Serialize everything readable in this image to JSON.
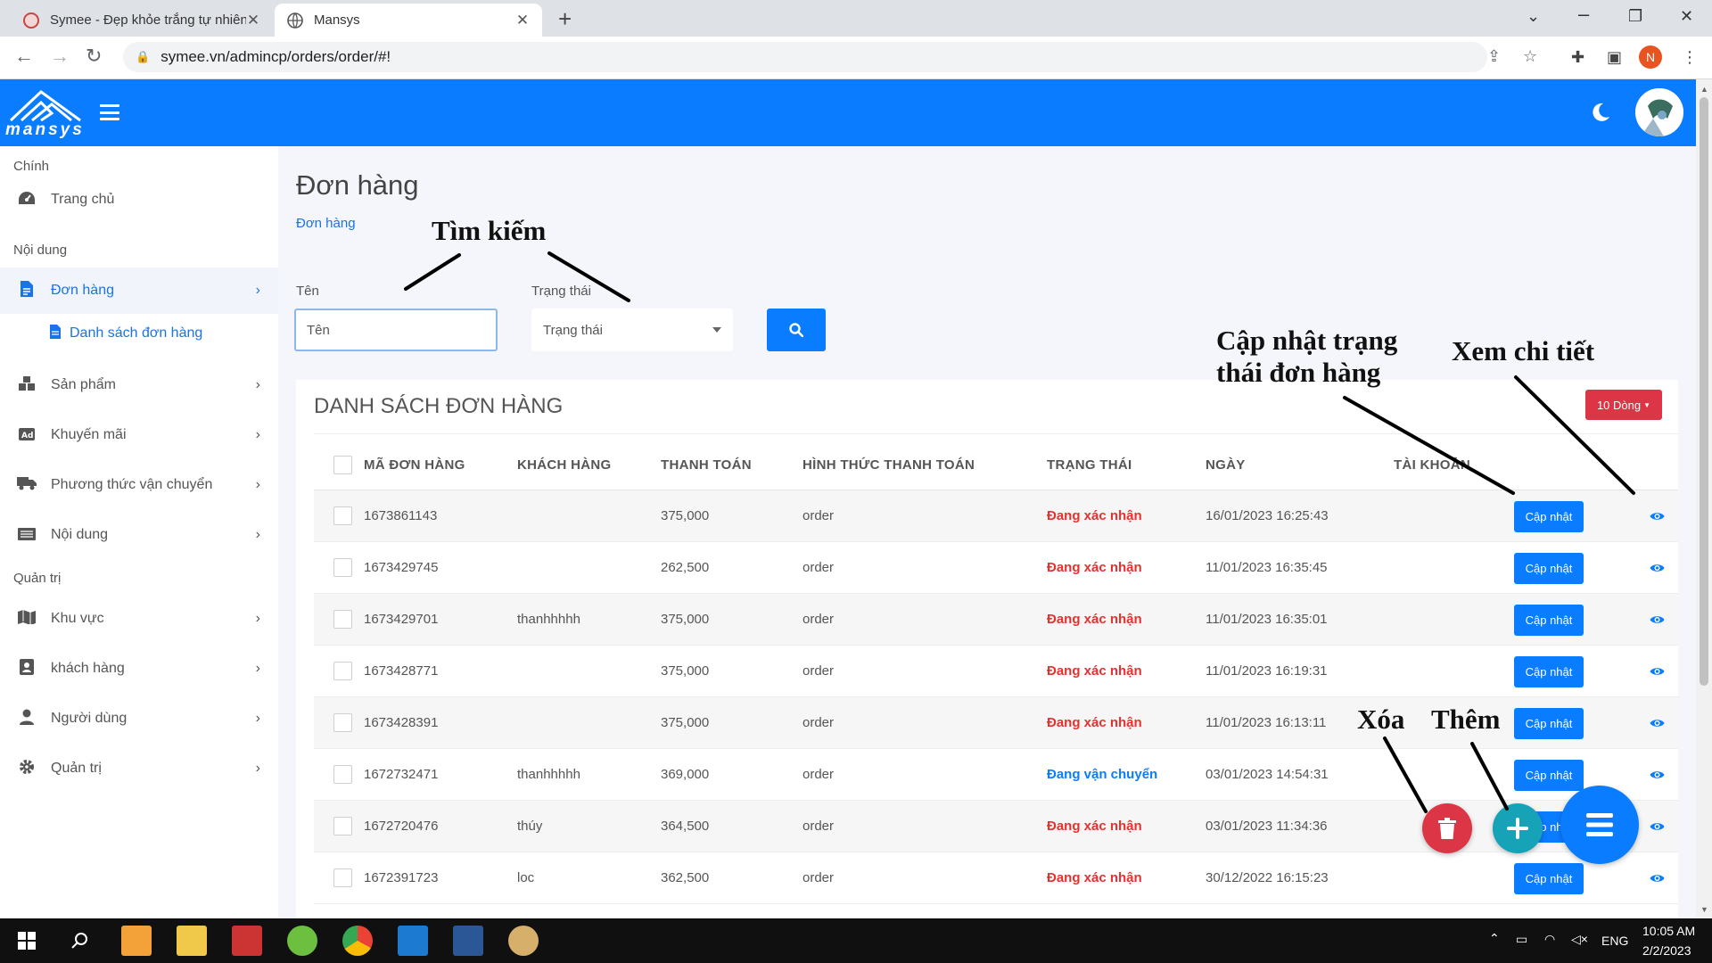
{
  "browser": {
    "tabs": [
      {
        "title": "Symee - Đẹp khỏe trắng tự nhiên",
        "active": false
      },
      {
        "title": "Mansys",
        "active": true
      }
    ],
    "url": "symee.vn/admincp/orders/order/#!",
    "profile_initial": "N"
  },
  "app": {
    "logo_text": "mansys",
    "brand_color": "#0a7cff"
  },
  "sidebar": {
    "section_main": "Chính",
    "section_content": "Nội dung",
    "section_admin": "Quản trị",
    "items": [
      {
        "label": "Trang chủ",
        "icon": "dashboard-icon"
      },
      {
        "label": "Đơn hàng",
        "icon": "invoice-icon",
        "active": true
      },
      {
        "label": "Sản phẩm",
        "icon": "boxes-icon"
      },
      {
        "label": "Khuyến mãi",
        "icon": "ad-icon"
      },
      {
        "label": "Phương thức vận chuyển",
        "icon": "truck-icon"
      },
      {
        "label": "Nội dung",
        "icon": "news-icon"
      },
      {
        "label": "Khu vực",
        "icon": "map-icon"
      },
      {
        "label": "khách hàng",
        "icon": "contact-icon"
      },
      {
        "label": "Người dùng",
        "icon": "user-icon"
      },
      {
        "label": "Quản trị",
        "icon": "gear-icon"
      }
    ],
    "subitem": "Danh sách đơn hàng"
  },
  "page": {
    "title": "Đơn hàng",
    "breadcrumb": "Đơn hàng",
    "filter": {
      "name_label": "Tên",
      "name_placeholder": "Tên",
      "status_label": "Trạng thái",
      "status_value": "Trạng thái"
    }
  },
  "table": {
    "title": "DANH SÁCH ĐƠN HÀNG",
    "rows_button": "10 Dòng",
    "columns": [
      "MÃ ĐƠN HÀNG",
      "KHÁCH HÀNG",
      "THANH TOÁN",
      "HÌNH THỨC THANH TOÁN",
      "TRẠNG THÁI",
      "NGÀY",
      "TÀI KHOẢN"
    ],
    "update_label": "Cập nhật",
    "rows": [
      {
        "id": "1673861143",
        "customer": "",
        "amount": "375,000",
        "method": "order",
        "status": "Đang xác nhận",
        "status_color": "#e5312f",
        "date": "16/01/2023 16:25:43"
      },
      {
        "id": "1673429745",
        "customer": "",
        "amount": "262,500",
        "method": "order",
        "status": "Đang xác nhận",
        "status_color": "#e5312f",
        "date": "11/01/2023 16:35:45"
      },
      {
        "id": "1673429701",
        "customer": "thanhhhhh",
        "amount": "375,000",
        "method": "order",
        "status": "Đang xác nhận",
        "status_color": "#e5312f",
        "date": "11/01/2023 16:35:01"
      },
      {
        "id": "1673428771",
        "customer": "",
        "amount": "375,000",
        "method": "order",
        "status": "Đang xác nhận",
        "status_color": "#e5312f",
        "date": "11/01/2023 16:19:31"
      },
      {
        "id": "1673428391",
        "customer": "",
        "amount": "375,000",
        "method": "order",
        "status": "Đang xác nhận",
        "status_color": "#e5312f",
        "date": "11/01/2023 16:13:11"
      },
      {
        "id": "1672732471",
        "customer": "thanhhhhh",
        "amount": "369,000",
        "method": "order",
        "status": "Đang vận chuyển",
        "status_color": "#0a7cff",
        "date": "03/01/2023 14:54:31"
      },
      {
        "id": "1672720476",
        "customer": "thúy",
        "amount": "364,500",
        "method": "order",
        "status": "Đang xác nhận",
        "status_color": "#e5312f",
        "date": "03/01/2023 11:34:36"
      },
      {
        "id": "1672391723",
        "customer": "loc",
        "amount": "362,500",
        "method": "order",
        "status": "Đang xác nhận",
        "status_color": "#e5312f",
        "date": "30/12/2022 16:15:23"
      }
    ]
  },
  "annotations": {
    "search": "Tìm kiếm",
    "update_status_line1": "Cập nhật trạng",
    "update_status_line2": "thái đơn hàng",
    "view_detail": "Xem chi tiết",
    "delete": "Xóa",
    "add": "Thêm"
  },
  "taskbar": {
    "lang": "ENG",
    "time": "10:05 AM",
    "date": "2/2/2023"
  }
}
